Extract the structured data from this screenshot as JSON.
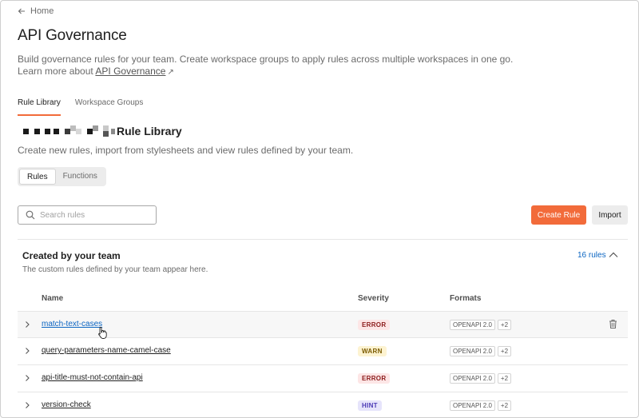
{
  "nav": {
    "back_label": "Home"
  },
  "page": {
    "title": "API Governance",
    "description": "Build governance rules for your team. Create workspace groups to apply rules across multiple workspaces in one go.",
    "learn_prefix": "Learn more about",
    "learn_link": "API Governance",
    "learn_icon": "external-link-icon"
  },
  "tabs": [
    {
      "label": "Rule Library",
      "active": true
    },
    {
      "label": "Workspace Groups",
      "active": false
    }
  ],
  "library": {
    "title": "Rule Library",
    "description": "Create new rules, import from stylesheets and view rules defined by your team."
  },
  "segments": [
    {
      "label": "Rules",
      "active": true
    },
    {
      "label": "Functions",
      "active": false
    }
  ],
  "search": {
    "placeholder": "Search rules",
    "value": ""
  },
  "actions": {
    "create_label": "Create Rule",
    "import_label": "Import"
  },
  "group": {
    "title": "Created by your team",
    "description": "The custom rules defined by your team appear here.",
    "count_label": "16 rules",
    "expanded": true
  },
  "table": {
    "columns": [
      "Name",
      "Severity",
      "Formats"
    ],
    "rows": [
      {
        "name": "match-text-cases",
        "severity": "ERROR",
        "severity_type": "error",
        "format": "OPENAPI 2.0",
        "more": "+2",
        "hovered": true
      },
      {
        "name": "query-parameters-name-camel-case",
        "severity": "WARN",
        "severity_type": "warn",
        "format": "OPENAPI 2.0",
        "more": "+2",
        "hovered": false
      },
      {
        "name": "api-title-must-not-contain-api",
        "severity": "ERROR",
        "severity_type": "error",
        "format": "OPENAPI 2.0",
        "more": "+2",
        "hovered": false
      },
      {
        "name": "version-check",
        "severity": "HINT",
        "severity_type": "hint",
        "format": "OPENAPI 2.0",
        "more": "+2",
        "hovered": false
      }
    ]
  },
  "colors": {
    "accent": "#f26b3a",
    "link": "#0b65c2",
    "error_bg": "#fde6e6",
    "warn_bg": "#fdf3d1",
    "hint_bg": "#e6e4fb"
  }
}
